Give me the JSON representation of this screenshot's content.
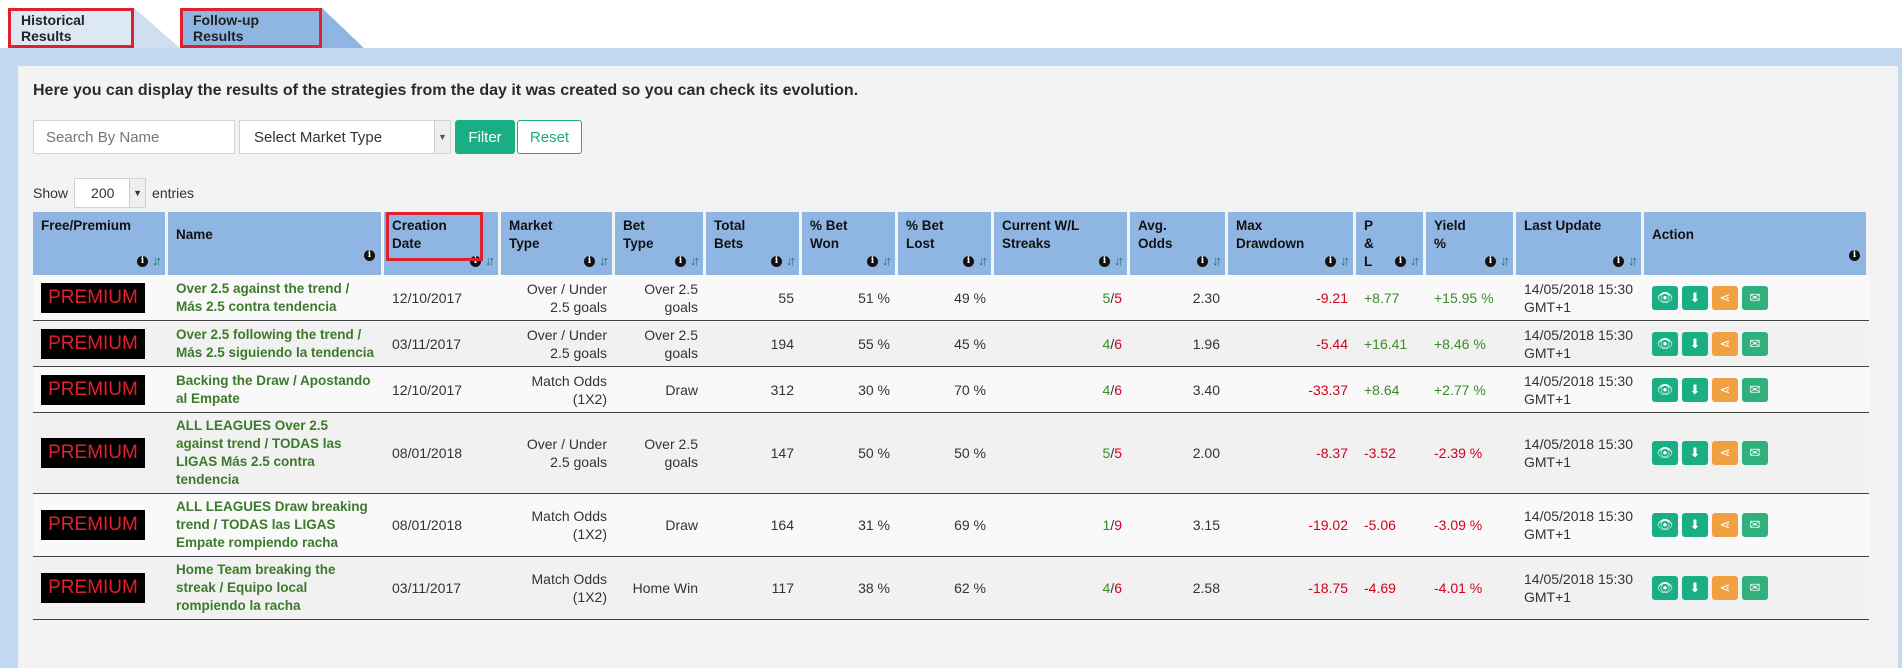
{
  "tabs": [
    {
      "label": "Historical Results"
    },
    {
      "label": "Follow-up Results"
    }
  ],
  "intro_text": "Here you can display the results of the strategies from the day it was created so you can check its evolution.",
  "filters": {
    "search_placeholder": "Search By Name",
    "market_select": "Select Market Type",
    "filter_label": "Filter",
    "reset_label": "Reset"
  },
  "show": {
    "prefix": "Show",
    "value": "200",
    "suffix": "entries"
  },
  "columns": [
    "Free/Premium",
    "Name",
    "Creation Date",
    "Market Type",
    "Bet Type",
    "Total Bets",
    "% Bet Won",
    "% Bet Lost",
    "Current W/L Streaks",
    "Avg. Odds",
    "Max Drawdown",
    "P & L",
    "Yield %",
    "Last Update",
    "Action"
  ],
  "rows": [
    {
      "badge": "PREMIUM",
      "name": "Over 2.5 against the trend / Más 2.5 contra tendencia",
      "date": "12/10/2017",
      "market": "Over / Under 2.5 goals",
      "bet": "Over 2.5 goals",
      "total": "55",
      "won": "51 %",
      "lost": "49 %",
      "w": "5",
      "l": "5",
      "odds": "2.30",
      "drawdown": "-9.21",
      "pl": "+8.77",
      "yield": "+15.95 %",
      "update": "14/05/2018 15:30 GMT+1"
    },
    {
      "badge": "PREMIUM",
      "name": "Over 2.5 following the trend / Más 2.5 siguiendo la tendencia",
      "date": "03/11/2017",
      "market": "Over / Under 2.5 goals",
      "bet": "Over 2.5 goals",
      "total": "194",
      "won": "55 %",
      "lost": "45 %",
      "w": "4",
      "l": "6",
      "odds": "1.96",
      "drawdown": "-5.44",
      "pl": "+16.41",
      "yield": "+8.46 %",
      "update": "14/05/2018 15:30 GMT+1"
    },
    {
      "badge": "PREMIUM",
      "name": "Backing the Draw / Apostando al Empate",
      "date": "12/10/2017",
      "market": "Match Odds (1X2)",
      "bet": "Draw",
      "total": "312",
      "won": "30 %",
      "lost": "70 %",
      "w": "4",
      "l": "6",
      "odds": "3.40",
      "drawdown": "-33.37",
      "pl": "+8.64",
      "yield": "+2.77 %",
      "update": "14/05/2018 15:30 GMT+1"
    },
    {
      "badge": "PREMIUM",
      "name": "ALL LEAGUES Over 2.5 against trend / TODAS las LIGAS Más 2.5 contra tendencia",
      "date": "08/01/2018",
      "market": "Over / Under 2.5 goals",
      "bet": "Over 2.5 goals",
      "total": "147",
      "won": "50 %",
      "lost": "50 %",
      "w": "5",
      "l": "5",
      "odds": "2.00",
      "drawdown": "-8.37",
      "pl": "-3.52",
      "yield": "-2.39 %",
      "update": "14/05/2018 15:30 GMT+1"
    },
    {
      "badge": "PREMIUM",
      "name": "ALL LEAGUES Draw breaking trend / TODAS las LIGAS Empate rompiendo racha",
      "date": "08/01/2018",
      "market": "Match Odds (1X2)",
      "bet": "Draw",
      "total": "164",
      "won": "31 %",
      "lost": "69 %",
      "w": "1",
      "l": "9",
      "odds": "3.15",
      "drawdown": "-19.02",
      "pl": "-5.06",
      "yield": "-3.09 %",
      "update": "14/05/2018 15:30 GMT+1"
    },
    {
      "badge": "PREMIUM",
      "name": "Home Team breaking the streak / Equipo local rompiendo la racha",
      "date": "03/11/2017",
      "market": "Match Odds (1X2)",
      "bet": "Home Win",
      "total": "117",
      "won": "38 %",
      "lost": "62 %",
      "w": "4",
      "l": "6",
      "odds": "2.58",
      "drawdown": "-18.75",
      "pl": "-4.69",
      "yield": "-4.01 %",
      "update": "14/05/2018 15:30 GMT+1"
    }
  ],
  "action_icons": [
    "eye-icon",
    "download-icon",
    "share-icon",
    "envelope-icon"
  ],
  "colors": {
    "header": "#8fb6e3",
    "accent": "#1aae84",
    "highlight": "#e0202e",
    "positive": "#3c8a2c",
    "negative": "#d0021b"
  }
}
